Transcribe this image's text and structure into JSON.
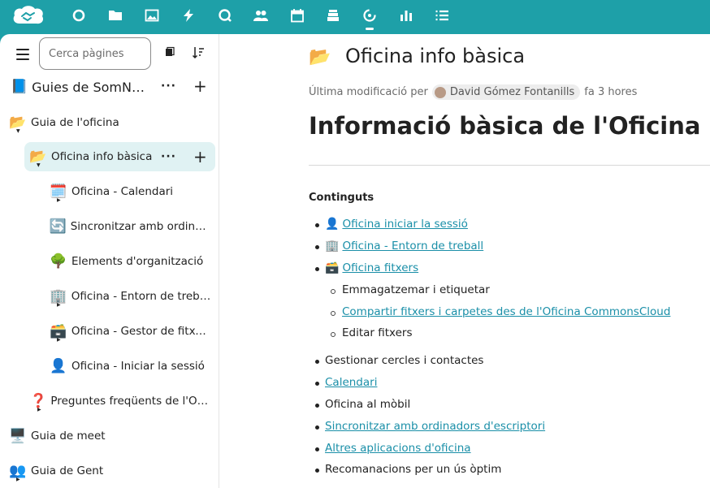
{
  "topbar": {
    "apps": [
      "logo-icon",
      "circle-icon",
      "folder-icon",
      "image-icon",
      "bolt-icon",
      "search-bubble-icon",
      "contacts-icon",
      "calendar-icon",
      "stack-icon",
      "collectives-icon",
      "chart-icon",
      "list-icon"
    ],
    "accent": "#1ea0a8"
  },
  "sidebar": {
    "search_placeholder": "Cerca pàgines",
    "collective": {
      "emoji": "📘",
      "label": "Guies de SomNú..."
    },
    "items": [
      {
        "emoji": "📂",
        "label": "Guia de l'oficina",
        "level": 0
      },
      {
        "emoji": "📂",
        "label": "Oficina info bàsica",
        "level": 1,
        "selected": true
      },
      {
        "emoji": "🗓️",
        "label": "Oficina - Calendari",
        "level": 2
      },
      {
        "emoji": "🔄",
        "label": "Sincronitzar amb ordinad...",
        "level": 2
      },
      {
        "emoji": "🌳",
        "label": "Elements d'organització",
        "level": 2
      },
      {
        "emoji": "🏢",
        "label": "Oficina - Entorn de treball",
        "level": 2
      },
      {
        "emoji": "🗃️",
        "label": "Oficina - Gestor de fitxers",
        "level": 2
      },
      {
        "emoji": "👤",
        "label": "Oficina - Iniciar la sessió",
        "level": 2
      },
      {
        "emoji": "❓",
        "label": "Preguntes freqüents de l'Ofici...",
        "level": 1
      },
      {
        "emoji": "🖥️",
        "label": "Guia de meet",
        "level": 0
      },
      {
        "emoji": "👥",
        "label": "Guia de Gent",
        "level": 0
      }
    ]
  },
  "page": {
    "title_emoji": "📂",
    "title": "Oficina info bàsica",
    "meta_prefix": "Última modificació per",
    "author": "David Gómez Fontanills",
    "meta_time": "fa 3 hores",
    "heading": "Informació bàsica de l'Oficina 📂",
    "contents_label": "Continguts",
    "list": [
      {
        "icon": "👤",
        "text": "Oficina iniciar la sessió",
        "link": true,
        "level": 0
      },
      {
        "icon": "🏢",
        "text": "Oficina - Entorn de treball",
        "link": true,
        "level": 0
      },
      {
        "icon": "🗃️",
        "text": "Oficina fitxers",
        "link": true,
        "level": 0
      },
      {
        "icon": "",
        "text": "Emmagatzemar i etiquetar",
        "link": false,
        "level": 1
      },
      {
        "icon": "",
        "text": "Compartir fitxers i carpetes des de l'Oficina CommonsCloud",
        "link": true,
        "level": 1
      },
      {
        "icon": "",
        "text": "Editar fitxers",
        "link": false,
        "level": 1
      },
      {
        "icon": "",
        "text": "Gestionar cercles i contactes",
        "link": false,
        "level": 0
      },
      {
        "icon": "",
        "text": "Calendari",
        "link": true,
        "level": 0
      },
      {
        "icon": "",
        "text": "Oficina al mòbil",
        "link": false,
        "level": 0
      },
      {
        "icon": "",
        "text": "Sincronitzar amb ordinadors d'escriptori",
        "link": true,
        "level": 0
      },
      {
        "icon": "",
        "text": "Altres aplicacions d'oficina ",
        "link": true,
        "level": 0
      },
      {
        "icon": "",
        "text": "Recomanacions per un ús òptim",
        "link": false,
        "level": 0
      }
    ]
  }
}
